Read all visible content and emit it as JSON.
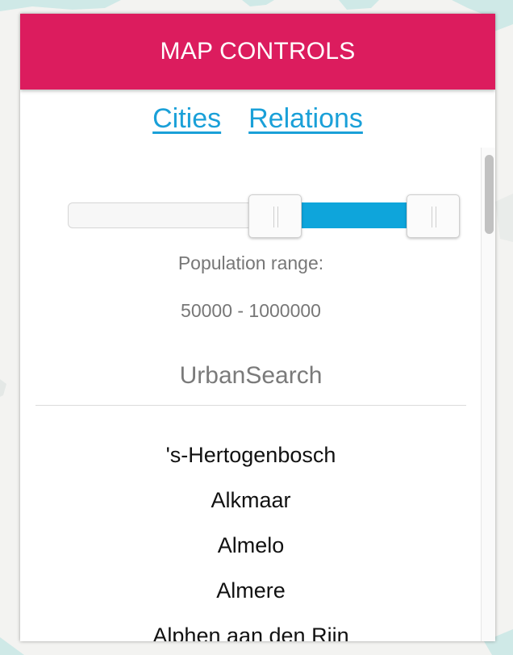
{
  "header": {
    "title": "MAP CONTROLS"
  },
  "tabs": [
    {
      "label": "Cities"
    },
    {
      "label": "Relations"
    }
  ],
  "slider": {
    "min_value": 50000,
    "max_value": 1000000,
    "label": "Population range:",
    "value_text": "50000 - 1000000"
  },
  "source": {
    "name": "UrbanSearch"
  },
  "cities": [
    "'s-Hertogenbosch",
    "Alkmaar",
    "Almelo",
    "Almere",
    "Alphen aan den Rijn"
  ],
  "colors": {
    "header": "#dc1c5e",
    "link": "#1aa0d8",
    "slider_fill": "#0ea5db"
  },
  "icons": [
    "slider-grip-icon",
    "scrollbar-thumb"
  ]
}
